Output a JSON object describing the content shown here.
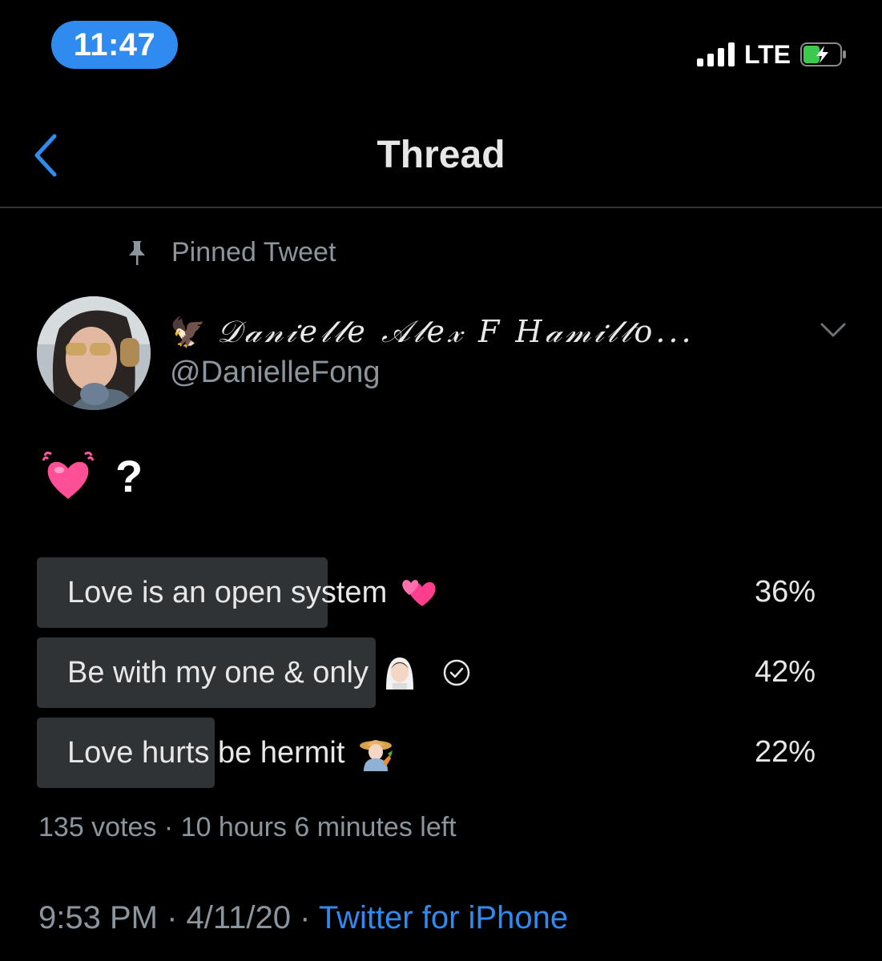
{
  "status_bar": {
    "time": "11:47",
    "network": "LTE"
  },
  "nav": {
    "title": "Thread"
  },
  "pinned": {
    "label": "Pinned Tweet"
  },
  "author": {
    "display_name": "𝒟𝒶𝓃𝒾𝑒𝓁𝓁𝑒 𝒜𝓁𝑒𝓍 𝐹 𝐻𝒶𝓂𝒾𝓁𝓉𝑜...",
    "handle": "@DanielleFong"
  },
  "tweet": {
    "text": "?"
  },
  "poll": {
    "options": [
      {
        "label": "Love is an open system",
        "percent": "36%",
        "fraction": 0.36,
        "emoji": "hearts-emoji",
        "selected": false
      },
      {
        "label": "Be with my one & only",
        "percent": "42%",
        "fraction": 0.42,
        "emoji": "bride-emoji",
        "selected": true
      },
      {
        "label": "Love hurts be hermit",
        "percent": "22%",
        "fraction": 0.22,
        "emoji": "farmer-emoji",
        "selected": false
      }
    ],
    "meta": "135 votes · 10 hours 6 minutes left"
  },
  "footer": {
    "timestamp": "9:53 PM · 4/11/20 · ",
    "source": "Twitter for iPhone"
  },
  "colors": {
    "accent": "#2f8bf0",
    "background": "#000000",
    "muted": "#8b959e",
    "poll_bar": "#2f3336"
  }
}
